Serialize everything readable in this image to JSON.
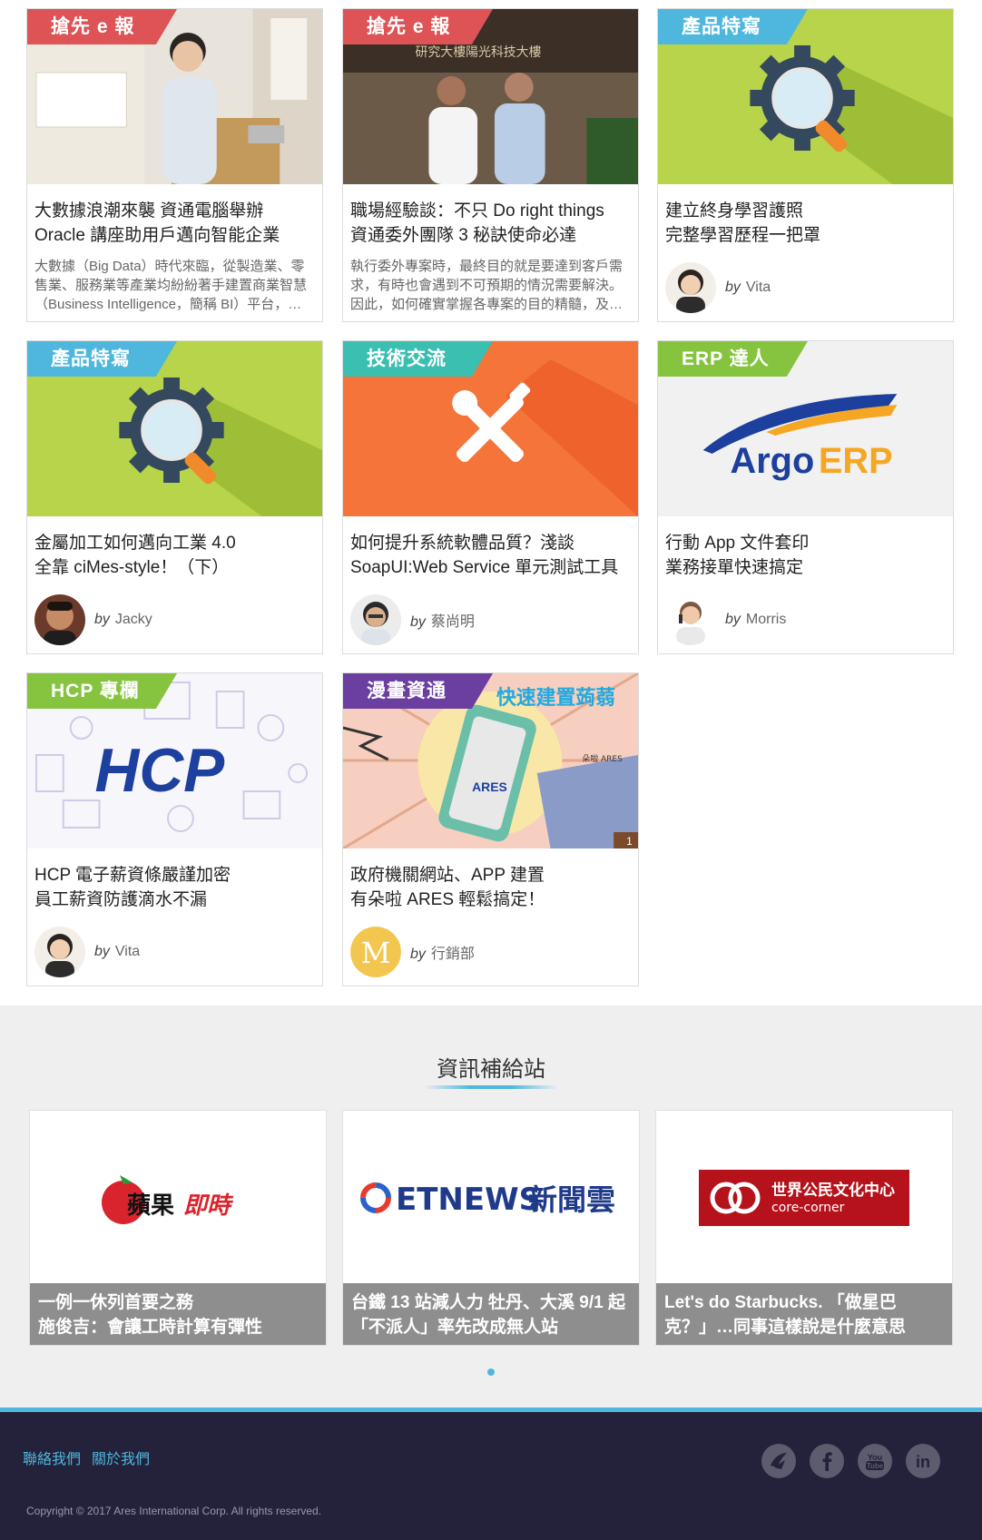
{
  "cards": [
    {
      "tag": "搶先 e 報",
      "title_1": "大數據浪潮來襲 資通電腦舉辦",
      "title_2": "Oracle 講座助用戶邁向智能企業",
      "excerpt": "大數據（Big Data）時代來臨，從製造業、零售業、服務業等產業均紛紛著手建置商業智慧（Business Intelligence，簡稱 BI）平台，…"
    },
    {
      "tag": "搶先 e 報",
      "title_1": "職場經驗談：不只 Do right things",
      "title_2": "資通委外團隊 3 秘訣使命必達",
      "excerpt": "執行委外專案時，最終目的就是要達到客戶需求，有時也會遇到不可預期的情況需要解決。因此，如何確實掌握各專案的目的精髓，及…",
      "building_sign": "研究大樓陽光科技大樓"
    },
    {
      "tag": "產品特寫",
      "title_1": "建立終身學習護照",
      "title_2": "完整學習歷程一把罩",
      "by": "by",
      "author": "Vita"
    },
    {
      "tag": "產品特寫",
      "title_1": "金屬加工如何邁向工業 4.0",
      "title_2": "全靠 ciMes-style！（下）",
      "by": "by",
      "author": "Jacky"
    },
    {
      "tag": "技術交流",
      "title_1": "如何提升系統軟體品質？淺談",
      "title_2": "SoapUI:Web Service 單元測試工具",
      "by": "by",
      "author": "蔡尚明"
    },
    {
      "tag": "ERP 達人",
      "title_1": "行動 App 文件套印",
      "title_2": "業務接單快速搞定",
      "by": "by",
      "author": "Morris",
      "logo_text_1": "Argo",
      "logo_text_2": "ERP"
    },
    {
      "tag": "HCP 專欄",
      "title_1": "HCP 電子薪資條嚴謹加密",
      "title_2": "員工薪資防護滴水不漏",
      "by": "by",
      "author": "Vita",
      "logo_text": "HCP"
    },
    {
      "tag": "漫畫資通",
      "title_1": "政府機關網站、APP 建置",
      "title_2": "有朵啦 ARES 輕鬆搞定！",
      "by": "by",
      "author": "行銷部",
      "comic_banner": "快速建置蒟蒻",
      "comic_sign": "朵啦 ARES",
      "comic_page": "1",
      "phone_logo": "ARES",
      "avatar_letter": "M"
    }
  ],
  "news_section": {
    "title": "資訊補給站",
    "items": [
      {
        "logo_1": "蘋果",
        "logo_2": "即時",
        "caption_1": "一例一休列首要之務",
        "caption_2": "施俊吉：會讓工時計算有彈性"
      },
      {
        "logo_1": "ETNEWS",
        "logo_2": "新聞雲",
        "caption_1": "台鐵 13 站減人力 牡丹、大溪 9/1 起",
        "caption_2": "「不派人」率先改成無人站"
      },
      {
        "logo_1": "世界公民文化中心",
        "logo_2": "core-corner",
        "caption_1": "Let's do Starbucks. 「做星巴",
        "caption_2": "克？」…同事這樣說是什麼意思"
      }
    ]
  },
  "footer": {
    "links": [
      "聯絡我們",
      "關於我們"
    ],
    "copyright": "Copyright © 2017 Ares International Corp. All rights reserved.",
    "social": [
      "ares-icon",
      "facebook-icon",
      "youtube-icon",
      "linkedin-icon"
    ],
    "youtube_label_1": "You",
    "youtube_label_2": "Tube",
    "linkedin_label": "in"
  },
  "colors": {
    "accent": "#4fb7dd",
    "tag_red": "#de5355",
    "tag_green": "#86c440",
    "tag_teal": "#3bbfb1",
    "tag_purple": "#6b3fa0",
    "footer_bg": "#24213a",
    "orange_card": "#f4743a",
    "lime_card": "#b7d44b"
  }
}
